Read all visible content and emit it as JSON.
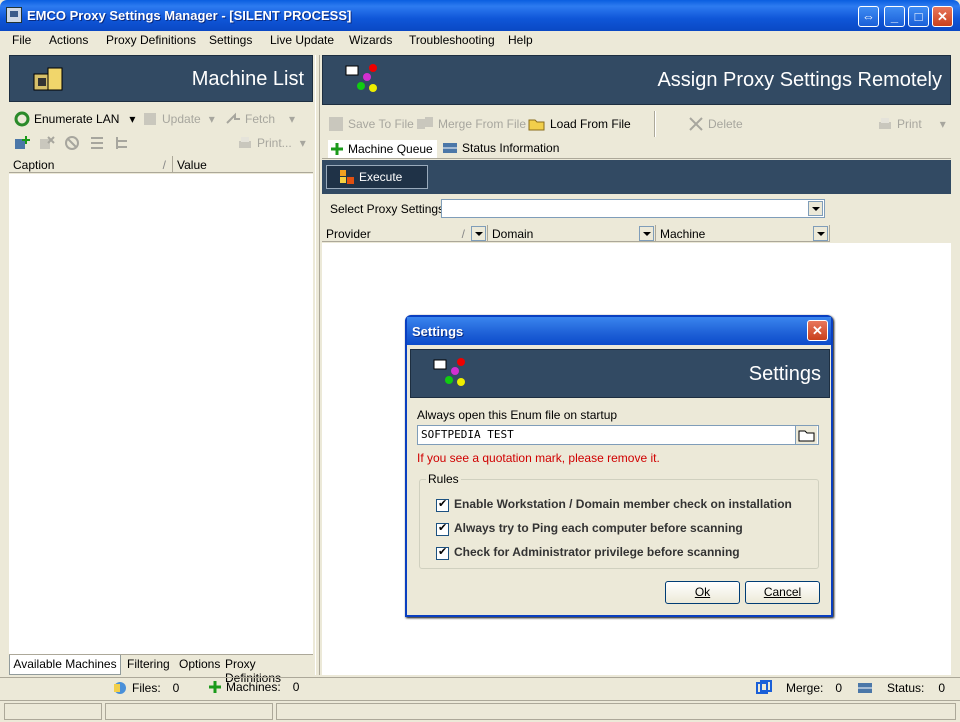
{
  "window": {
    "title": "EMCO Proxy Settings Manager - [SILENT PROCESS]"
  },
  "menu": [
    "File",
    "Actions",
    "Proxy Definitions",
    "Settings",
    "Live Update",
    "Wizards",
    "Troubleshooting",
    "Help"
  ],
  "left": {
    "header": "Machine List",
    "toolbar": {
      "enumerate": "Enumerate LAN",
      "update": "Update",
      "fetch": "Fetch",
      "print": "Print..."
    },
    "columns": [
      "Caption",
      "Value"
    ],
    "tabs": [
      "Available Machines",
      "Filtering",
      "Options",
      "Proxy Definitions"
    ]
  },
  "right": {
    "header": "Assign Proxy Settings Remotely",
    "toolbar": {
      "save": "Save To File",
      "merge": "Merge From File",
      "load": "Load From File",
      "delete": "Delete",
      "print": "Print"
    },
    "tabs": [
      "Machine Queue",
      "Status Information"
    ],
    "execute": "Execute",
    "select_label": "Select Proxy Settings :",
    "columns": [
      "Provider",
      "Domain",
      "Machine"
    ]
  },
  "statusbar": {
    "files_label": "Files:",
    "files_value": "0",
    "machines_label": "Machines:",
    "machines_value": "0",
    "merge_label": "Merge:",
    "merge_value": "0",
    "status_label": "Status:",
    "status_value": "0"
  },
  "dialog": {
    "title": "Settings",
    "header": "Settings",
    "field_label": "Always open this Enum file on startup",
    "field_value": "SOFTPEDIA TEST",
    "warning": "If you see a quotation mark, please remove it.",
    "rules_label": "Rules",
    "rules": [
      "Enable Workstation / Domain member check on installation",
      "Always try to Ping each computer before scanning",
      "Check for Administrator privilege before scanning"
    ],
    "ok": "Ok",
    "cancel": "Cancel"
  }
}
